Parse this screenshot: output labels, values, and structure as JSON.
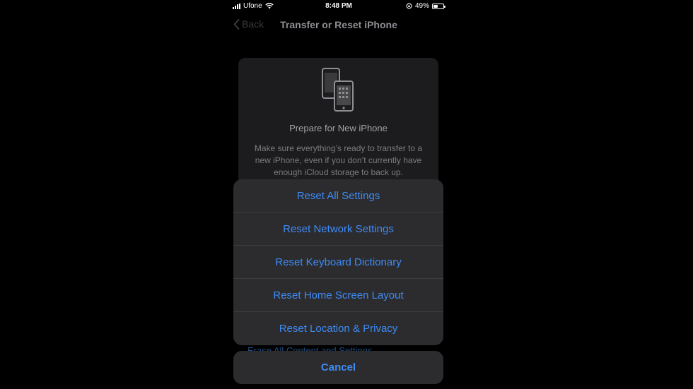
{
  "status_bar": {
    "carrier": "Ufone",
    "time": "8:48 PM",
    "battery_percent": "49%",
    "battery_level": 0.49
  },
  "nav": {
    "back_label": "Back",
    "title": "Transfer or Reset iPhone"
  },
  "prepare_card": {
    "icon": "two-phones-icon",
    "title": "Prepare for New iPhone",
    "description": "Make sure everything’s ready to transfer to a new iPhone, even if you don’t currently have enough iCloud storage to back up."
  },
  "background_link": "Erase All Content and Settings",
  "action_sheet": {
    "options": [
      "Reset All Settings",
      "Reset Network Settings",
      "Reset Keyboard Dictionary",
      "Reset Home Screen Layout",
      "Reset Location & Privacy"
    ],
    "cancel_label": "Cancel"
  },
  "colors": {
    "accent": "#3e8bf6",
    "sheet_bg": "#2c2c2e",
    "card_bg": "#1c1c1e"
  }
}
